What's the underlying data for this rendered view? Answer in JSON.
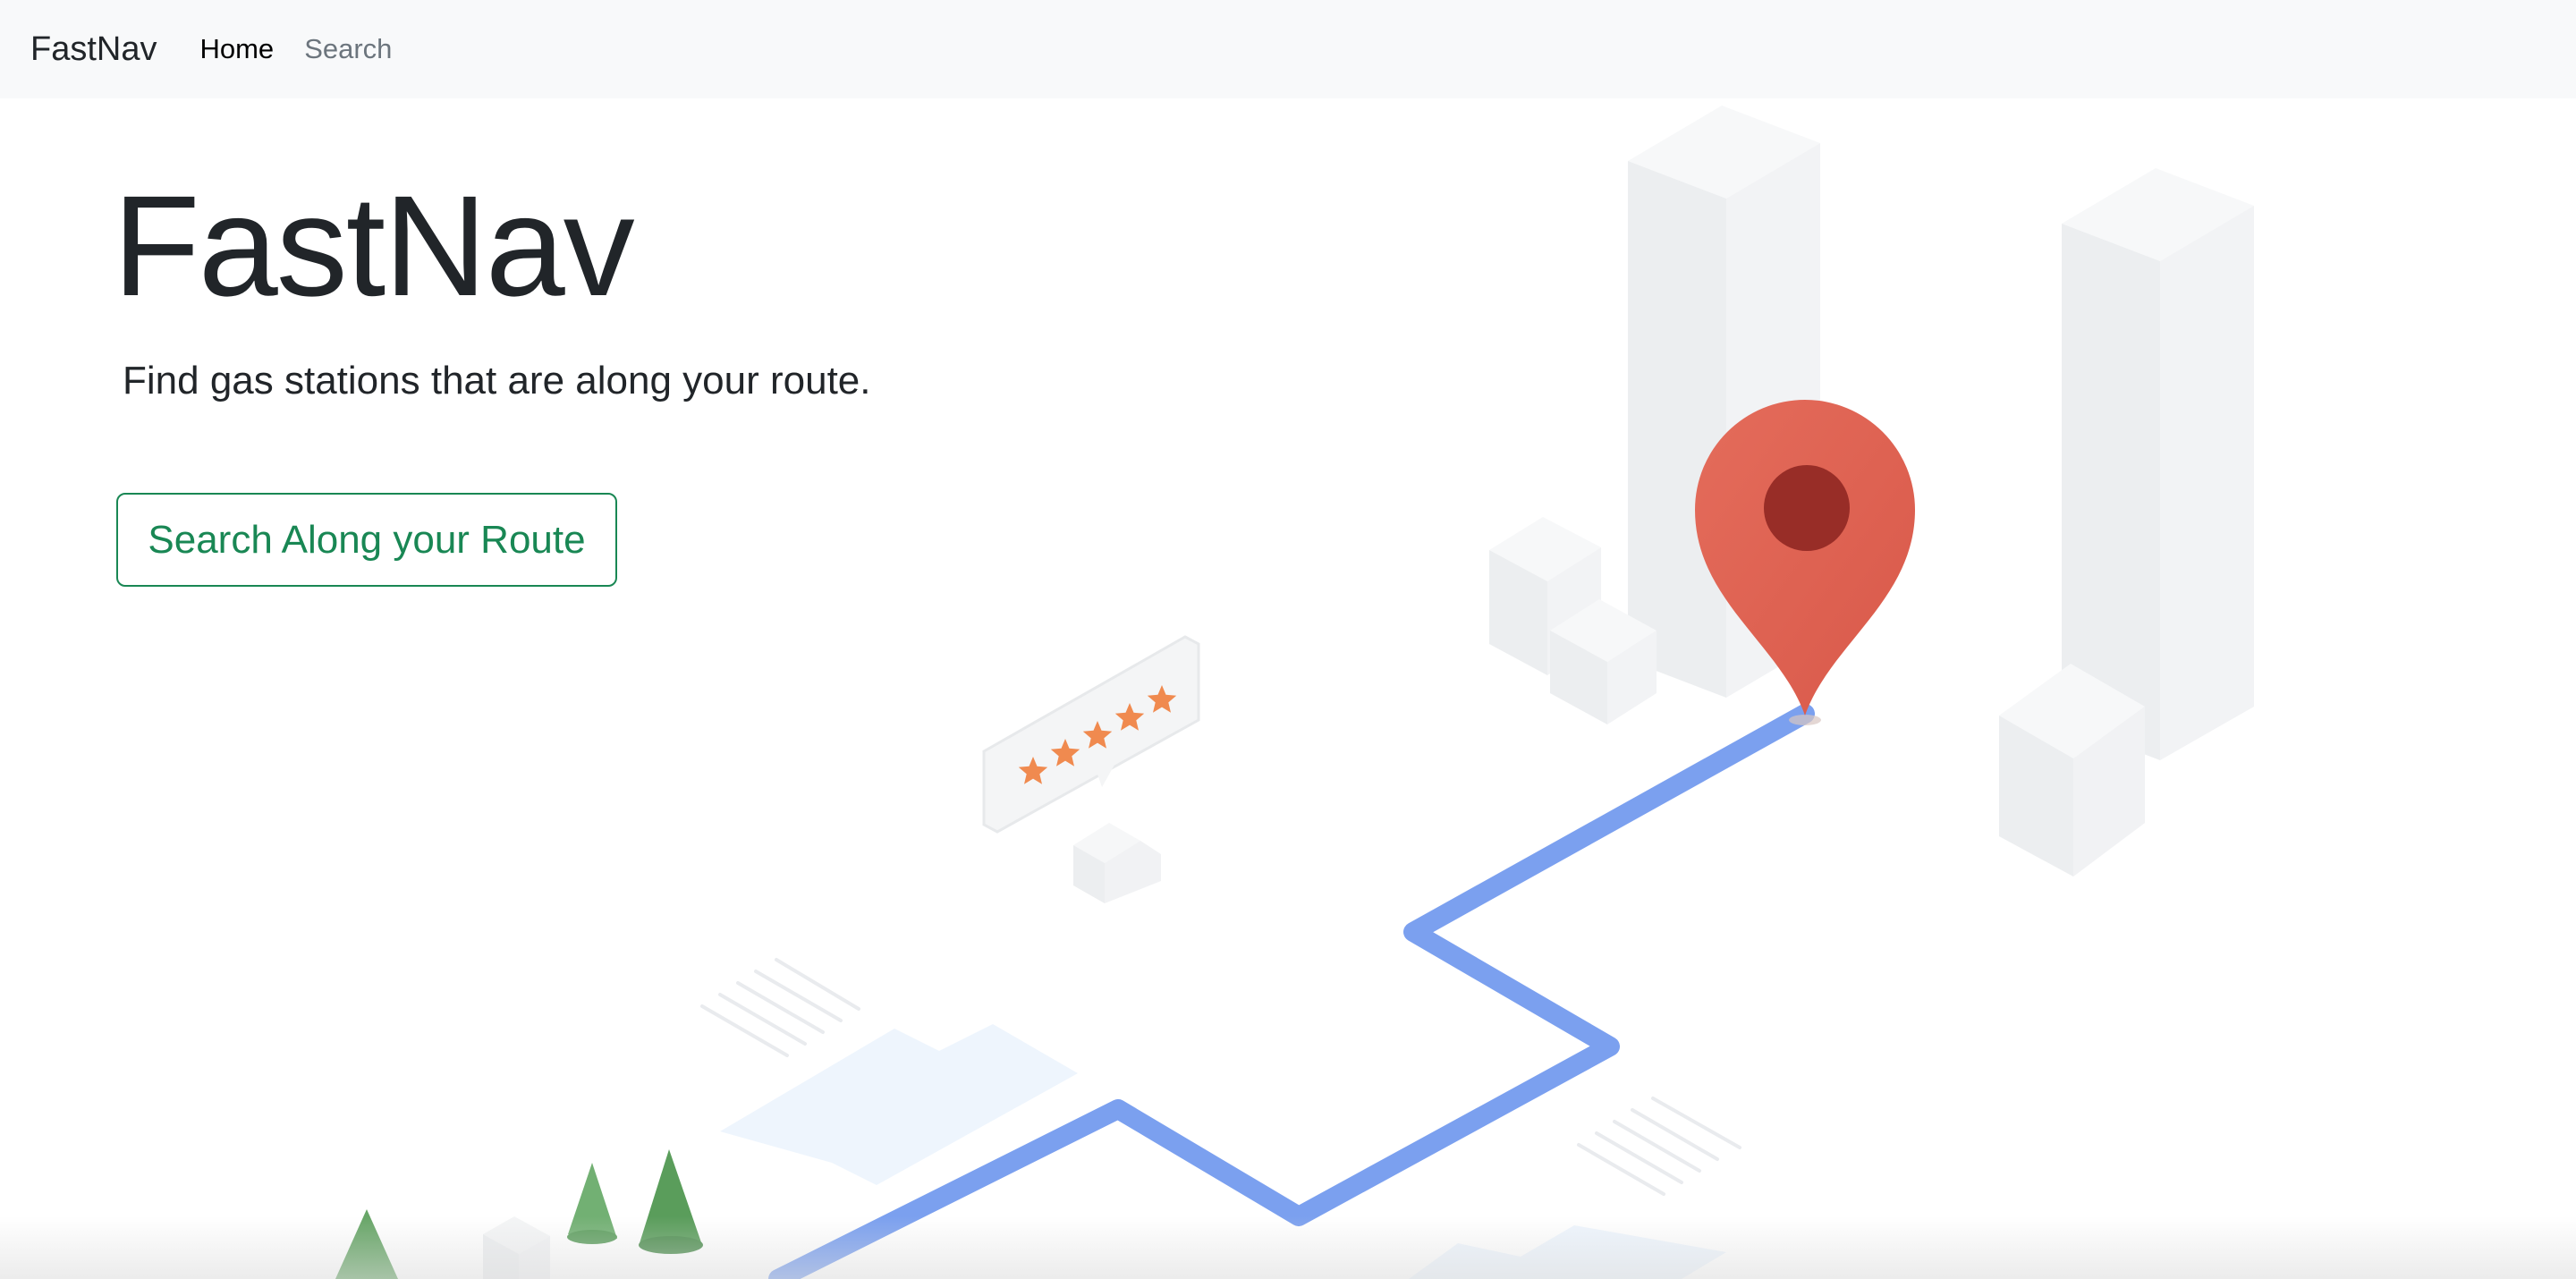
{
  "navbar": {
    "brand": "FastNav",
    "links": [
      {
        "label": "Home",
        "active": true
      },
      {
        "label": "Search",
        "active": false
      }
    ]
  },
  "hero": {
    "title": "FastNav",
    "subtitle": "Find gas stations that are along your route.",
    "cta_label": "Search Along your Route"
  },
  "illustration": {
    "icons": [
      "map-pin-icon",
      "star-icon",
      "building-icon",
      "tree-icon",
      "house-icon"
    ],
    "rating_stars": 5,
    "colors": {
      "route": "#7ba0ef",
      "pin": "#df5f4f",
      "pin_center": "#982d27",
      "stars": "#f08a4f",
      "trees": "#5f9f60",
      "buildings": "#eef0f2"
    }
  },
  "colors": {
    "navbar_bg": "#f8f9fa",
    "accent": "#198754",
    "text": "#212529",
    "muted": "#6c757d"
  }
}
